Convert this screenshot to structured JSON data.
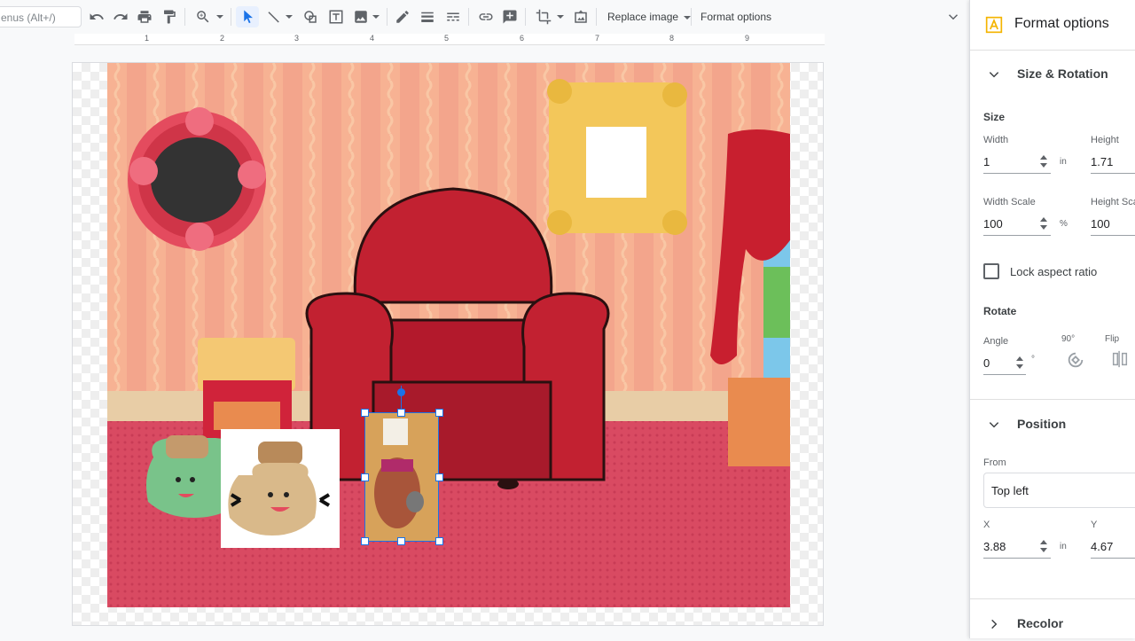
{
  "toolbar": {
    "search_placeholder": "enus (Alt+/)",
    "replace_image_label": "Replace image",
    "format_options_label": "Format options"
  },
  "ruler": {
    "numbers": [
      "1",
      "2",
      "3",
      "4",
      "5",
      "6",
      "7",
      "8",
      "9"
    ]
  },
  "panel": {
    "title": "Format options",
    "size_rotation": {
      "header": "Size & Rotation",
      "size_label": "Size",
      "width_label": "Width",
      "width_value": "1",
      "width_unit": "in",
      "height_label": "Height",
      "height_value": "1.71",
      "width_scale_label": "Width Scale",
      "width_scale_value": "100",
      "width_scale_unit": "%",
      "height_scale_label": "Height Sca",
      "height_scale_value": "100",
      "lock_label": "Lock aspect ratio",
      "rotate_label": "Rotate",
      "angle_label": "Angle",
      "angle_value": "0",
      "angle_unit": "°",
      "ninety_label": "90°",
      "flip_label": "Flip"
    },
    "position": {
      "header": "Position",
      "from_label": "From",
      "from_value": "Top left",
      "x_label": "X",
      "x_value": "3.88",
      "x_unit": "in",
      "y_label": "Y",
      "y_value": "4.67"
    },
    "recolor": {
      "header": "Recolor"
    }
  },
  "colors": {
    "accent": "#1a73e8",
    "wall": "#f3a58c",
    "carpet": "#d94a62",
    "chair": "#b3192c"
  }
}
